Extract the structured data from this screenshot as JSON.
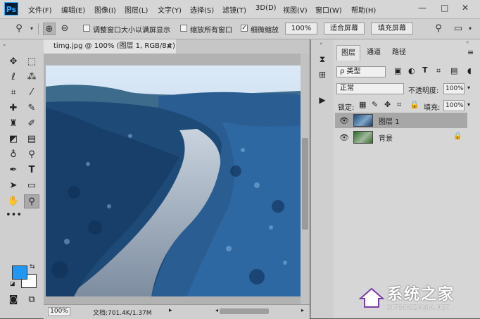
{
  "app": {
    "logo": "Ps"
  },
  "menu": [
    "文件(F)",
    "编辑(E)",
    "图像(I)",
    "图层(L)",
    "文字(Y)",
    "选择(S)",
    "滤镜(T)",
    "3D(D)",
    "视图(V)",
    "窗口(W)",
    "帮助(H)"
  ],
  "window_controls": {
    "minimize": "—",
    "maximize": "□",
    "close": "✕"
  },
  "options": {
    "checkbox1": "调整窗口大小以满屏显示",
    "checkbox2": "缩放所有窗口",
    "checkbox3": "细微缩放",
    "zoom_value": "100%",
    "fit_screen": "适合屏幕",
    "fill_screen": "填充屏幕"
  },
  "document": {
    "tab_title": "timg.jpg @ 100% (图层 1, RGB/8#) *",
    "close": "×"
  },
  "status": {
    "zoom": "100%",
    "doc_info": "文档:701.4K/1.37M"
  },
  "layers_panel": {
    "tabs": [
      "图层",
      "通道",
      "路径"
    ],
    "filter_kind": "ρ 类型",
    "blend_mode": "正常",
    "opacity_label": "不透明度:",
    "opacity_value": "100%",
    "lock_label": "锁定:",
    "fill_label": "填充:",
    "fill_value": "100%",
    "layers": [
      {
        "name": "图层 1",
        "selected": true
      },
      {
        "name": "背景",
        "selected": false,
        "locked": true
      }
    ]
  },
  "watermark": {
    "title": "系统之家",
    "subtitle": "XITONGZHIJIA.NET"
  },
  "colors": {
    "foreground": "#2196f3",
    "background": "#ffffff"
  }
}
